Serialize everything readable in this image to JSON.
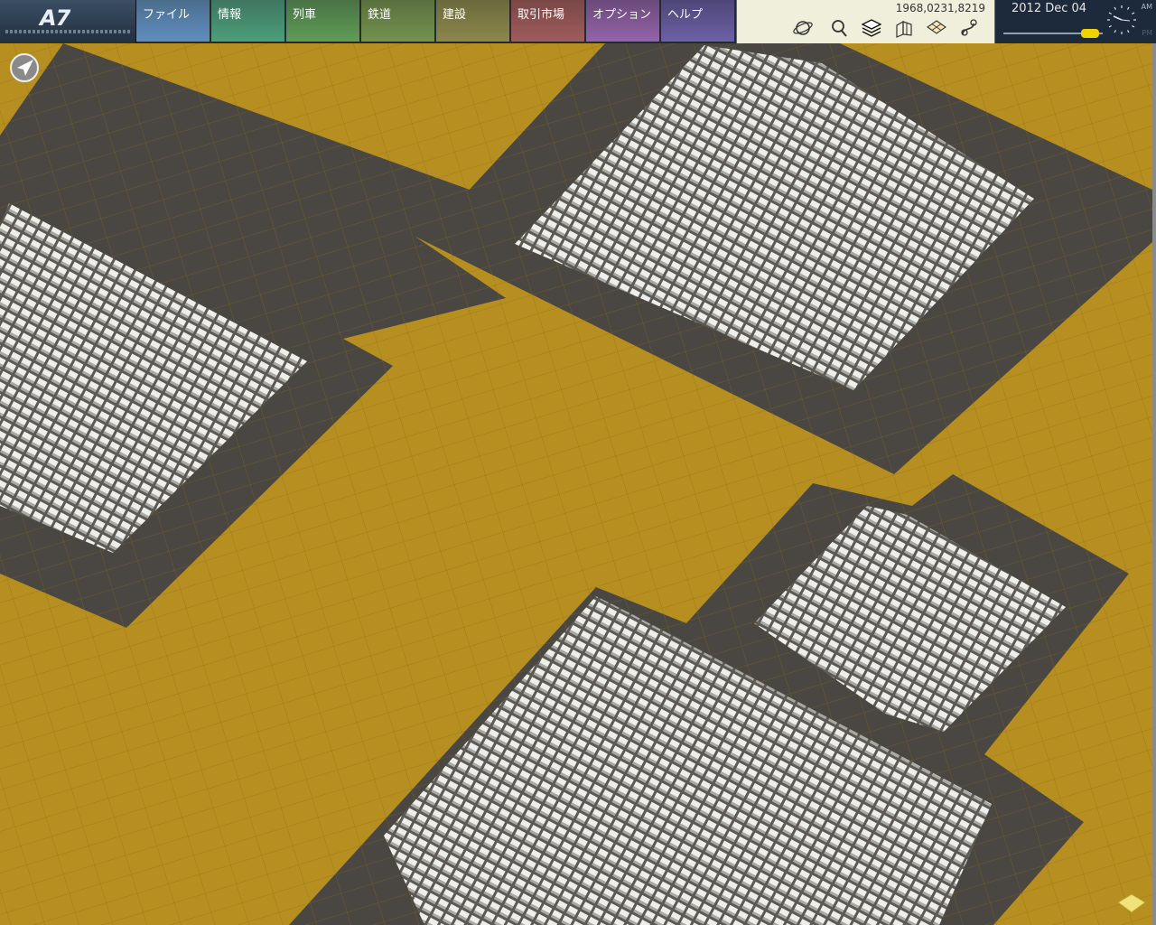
{
  "app": {
    "logo": "A7"
  },
  "menu": {
    "file": "ファイル",
    "info": "情報",
    "train": "列車",
    "rail": "鉄道",
    "build": "建設",
    "market": "取引市場",
    "option": "オプション",
    "help": "ヘルプ"
  },
  "toolbar": {
    "coordinates": "1968,0231,8219",
    "icons": [
      "globe-icon",
      "search-icon",
      "layers-icon",
      "buildings-icon",
      "grid-icon",
      "route-icon"
    ]
  },
  "clock": {
    "date": "2012 Dec 04",
    "am_label": "AM",
    "pm_label": "PM",
    "speed_level": 0.87
  },
  "colors": {
    "ground": "#b78f21",
    "road": "#4a4742",
    "building": "#d8d8d2"
  }
}
